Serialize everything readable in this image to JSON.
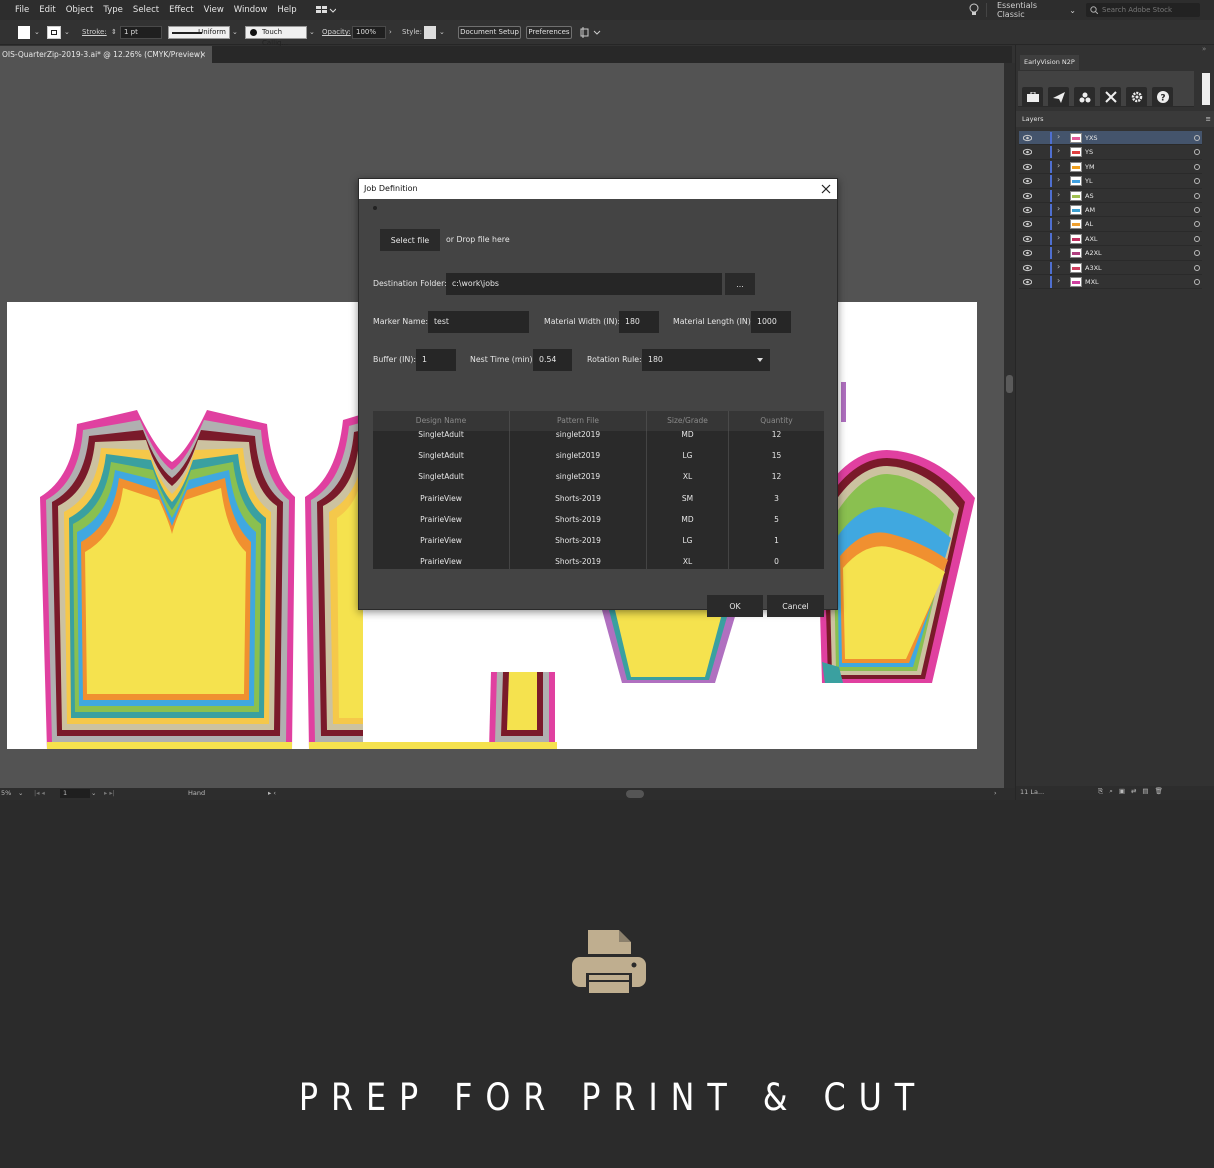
{
  "menu": [
    "File",
    "Edit",
    "Object",
    "Type",
    "Select",
    "Effect",
    "View",
    "Window",
    "Help"
  ],
  "workspace": "Essentials Classic",
  "search_placeholder": "Search Adobe Stock",
  "control": {
    "stroke_label": "Stroke:",
    "stroke_weight": "1 pt",
    "profile": "Uniform",
    "brush": "Touch Callig...",
    "opacity_label": "Opacity:",
    "opacity": "100%",
    "style_label": "Style:",
    "doc_setup": "Document Setup",
    "preferences": "Preferences"
  },
  "doc_tab": {
    "title": "OIS-QuarterZip-2019-3.ai* @ 12.26% (CMYK/Preview)",
    "close": "×"
  },
  "status": {
    "zoom": "5%",
    "artboard": "1",
    "tool": "Hand"
  },
  "panel": {
    "plugin_tab": "EarlyVision N2P",
    "layers_tab": "Layers",
    "layer_count": "11 La...",
    "layers": [
      {
        "name": "YXS",
        "color": "#e55a9a"
      },
      {
        "name": "YS",
        "color": "#e04040"
      },
      {
        "name": "YM",
        "color": "#f0a020"
      },
      {
        "name": "YL",
        "color": "#40a0e0"
      },
      {
        "name": "AS",
        "color": "#a0c050"
      },
      {
        "name": "AM",
        "color": "#3ca0d0"
      },
      {
        "name": "AL",
        "color": "#f0a030"
      },
      {
        "name": "AXL",
        "color": "#c03060"
      },
      {
        "name": "A2XL",
        "color": "#b04080"
      },
      {
        "name": "A3XL",
        "color": "#d04060"
      },
      {
        "name": "MXL",
        "color": "#d040a0"
      }
    ]
  },
  "dialog": {
    "title": "Job Definition",
    "select_file": "Select file",
    "drop_text": "or Drop file here",
    "dest_label": "Destination Folder:",
    "dest_value": "c:\\work\\jobs",
    "browse": "...",
    "marker_label": "Marker Name:",
    "marker_value": "test",
    "mat_width_label": "Material Width (IN):",
    "mat_width_value": "180",
    "mat_length_label": "Material Length (IN):",
    "mat_length_value": "1000",
    "buffer_label": "Buffer (IN):",
    "buffer_value": "1",
    "nest_label": "Nest Time (min):",
    "nest_value": "0.54",
    "rotation_label": "Rotation Rule:",
    "rotation_value": "180",
    "columns": [
      "Design Name",
      "Pattern File",
      "Size/Grade",
      "Quantity"
    ],
    "rows": [
      [
        "SingletAdult",
        "singlet2019",
        "MD",
        "12"
      ],
      [
        "SingletAdult",
        "singlet2019",
        "LG",
        "15"
      ],
      [
        "SingletAdult",
        "singlet2019",
        "XL",
        "12"
      ],
      [
        "PrairieView",
        "Shorts-2019",
        "SM",
        "3"
      ],
      [
        "PrairieView",
        "Shorts-2019",
        "MD",
        "5"
      ],
      [
        "PrairieView",
        "Shorts-2019",
        "LG",
        "1"
      ],
      [
        "PrairieView",
        "Shorts-2019",
        "XL",
        "0"
      ]
    ],
    "ok": "OK",
    "cancel": "Cancel"
  },
  "feature": {
    "title": "PREP FOR PRINT & CUT",
    "icon": "printer-icon",
    "icon_color": "#bfae8f"
  }
}
